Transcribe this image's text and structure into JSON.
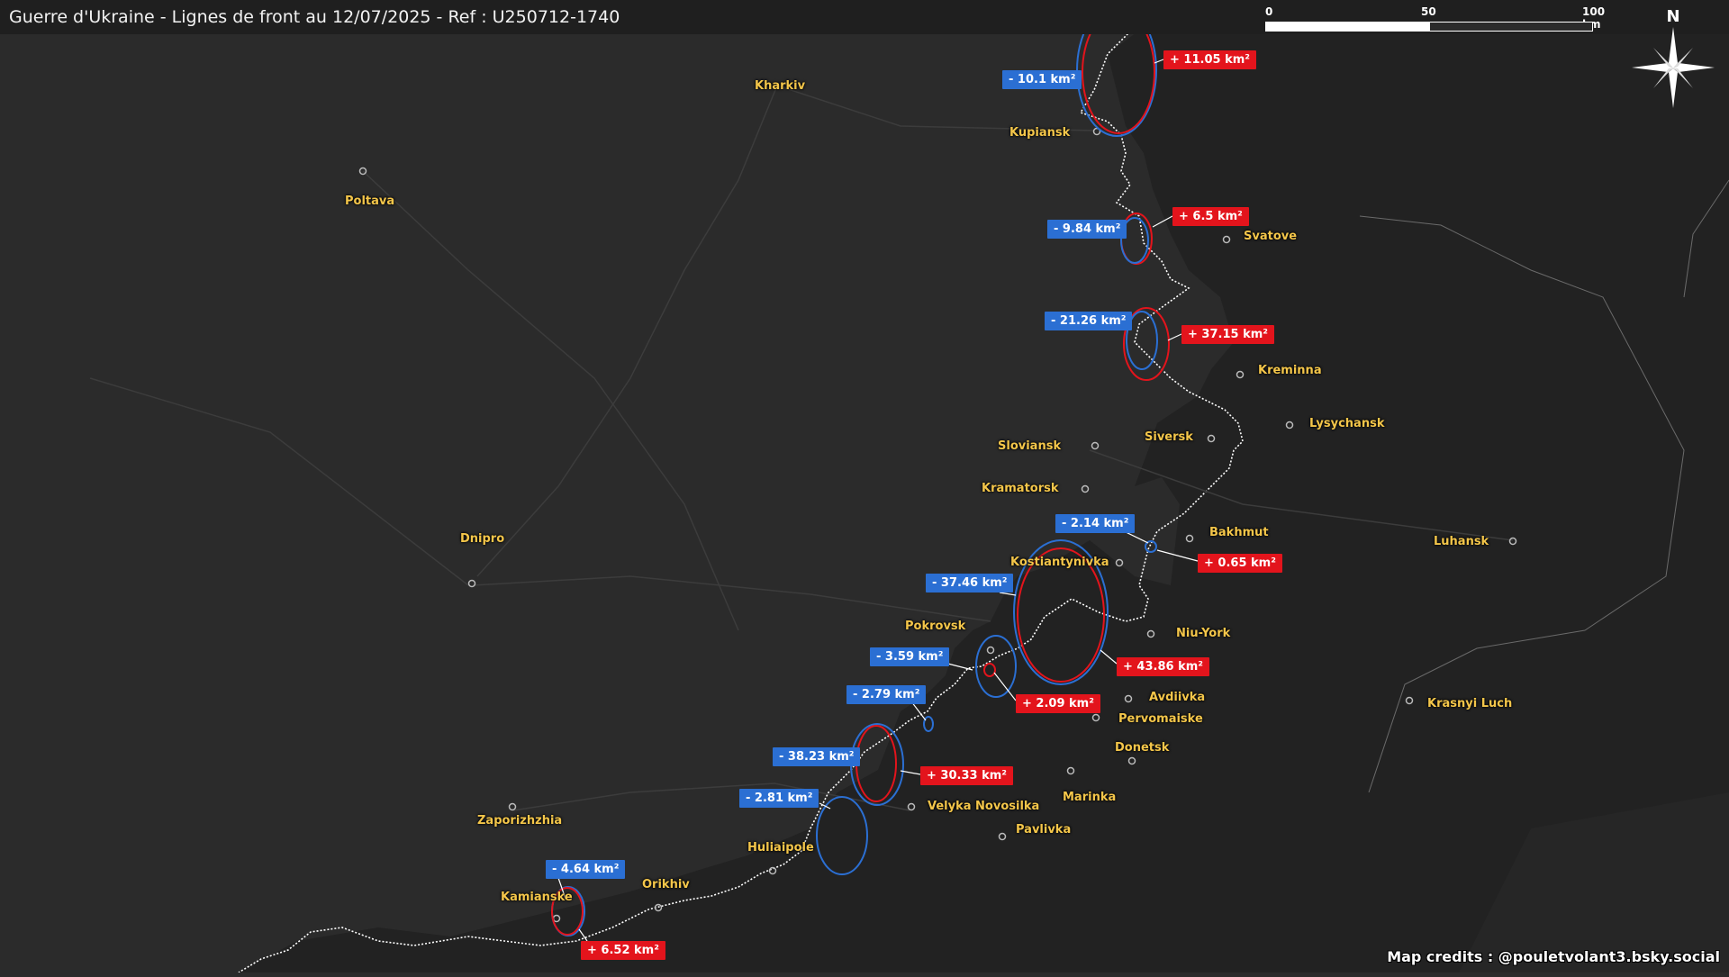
{
  "title": "Guerre d'Ukraine - Lignes de front au 12/07/2025 - Ref : U250712-1740",
  "scale": {
    "labels": [
      "0",
      "50",
      "100 km"
    ]
  },
  "compass": {
    "label": "N"
  },
  "credits": "Map credits : @pouletvolant3.bsky.social",
  "colors": {
    "background": "#2b2b2b",
    "occupied": "#222222",
    "front_line": "#ffffff",
    "loss": "#2b6fd3",
    "gain": "#e3141c",
    "city_label": "#f4c64a"
  },
  "cities": [
    {
      "name": "Kharkiv"
    },
    {
      "name": "Poltava"
    },
    {
      "name": "Kupiansk"
    },
    {
      "name": "Svatove"
    },
    {
      "name": "Kreminna"
    },
    {
      "name": "Lysychansk"
    },
    {
      "name": "Sloviansk"
    },
    {
      "name": "Siversk"
    },
    {
      "name": "Kramatorsk"
    },
    {
      "name": "Bakhmut"
    },
    {
      "name": "Luhansk"
    },
    {
      "name": "Kostiantynivka"
    },
    {
      "name": "Dnipro"
    },
    {
      "name": "Pokrovsk"
    },
    {
      "name": "Niu-York"
    },
    {
      "name": "Avdiivka"
    },
    {
      "name": "Pervomaiske"
    },
    {
      "name": "Krasnyi Luch"
    },
    {
      "name": "Donetsk"
    },
    {
      "name": "Marinka"
    },
    {
      "name": "Velyka Novosilka"
    },
    {
      "name": "Pavlivka"
    },
    {
      "name": "Zaporizhzhia"
    },
    {
      "name": "Huliaipole"
    },
    {
      "name": "Orikhiv"
    },
    {
      "name": "Kamianske"
    }
  ],
  "changes": [
    {
      "loss": "- 10.1 km²",
      "gain": "+ 11.05 km²"
    },
    {
      "loss": "- 9.84 km²",
      "gain": "+ 6.5 km²"
    },
    {
      "loss": "- 21.26 km²",
      "gain": "+ 37.15 km²"
    },
    {
      "loss": "- 2.14 km²",
      "gain": "+ 0.65 km²"
    },
    {
      "loss": "- 37.46 km²",
      "gain": "+ 43.86 km²"
    },
    {
      "loss": "- 3.59 km²",
      "gain": "+ 2.09 km²"
    },
    {
      "loss": "- 2.79 km²",
      "gain": ""
    },
    {
      "loss": "- 38.23 km²",
      "gain": "+ 30.33 km²"
    },
    {
      "loss": "- 2.81 km²",
      "gain": ""
    },
    {
      "loss": "- 4.64 km²",
      "gain": "+ 6.52 km²"
    }
  ]
}
